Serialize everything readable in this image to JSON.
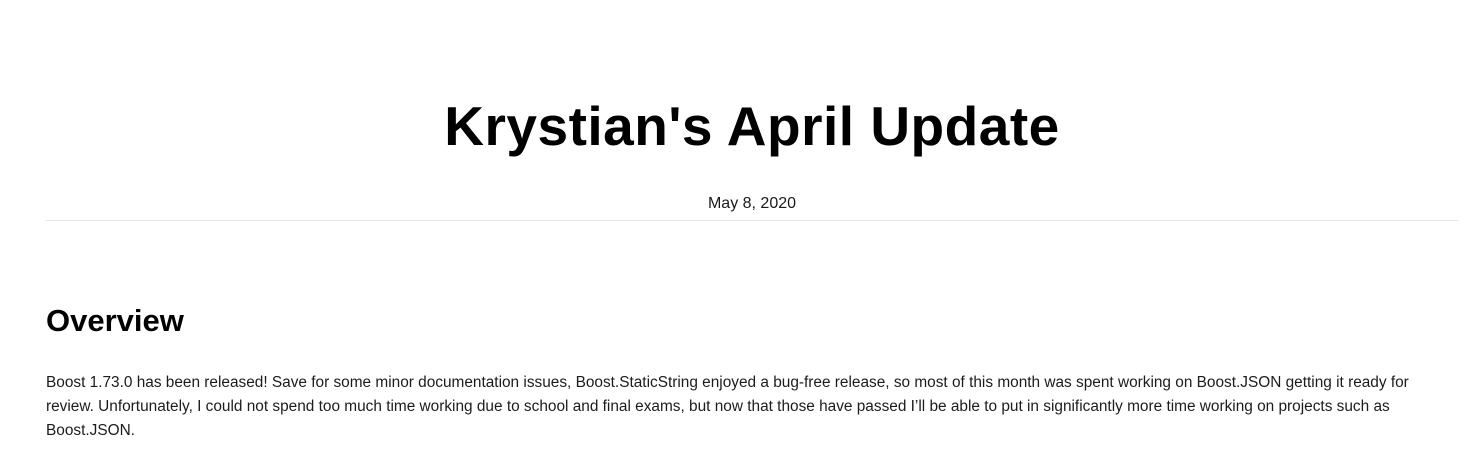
{
  "post": {
    "title": "Krystian's April Update",
    "date": "May 8, 2020"
  },
  "sections": [
    {
      "heading": "Overview",
      "paragraph": "Boost 1.73.0 has been released! Save for some minor documentation issues, Boost.StaticString enjoyed a bug-free release, so most of this month was spent working on Boost.JSON getting it ready for review. Unfortunately, I could not spend too much time working due to school and final exams, but now that those have passed I’ll be able to put in significantly more time working on projects such as Boost.JSON."
    }
  ]
}
